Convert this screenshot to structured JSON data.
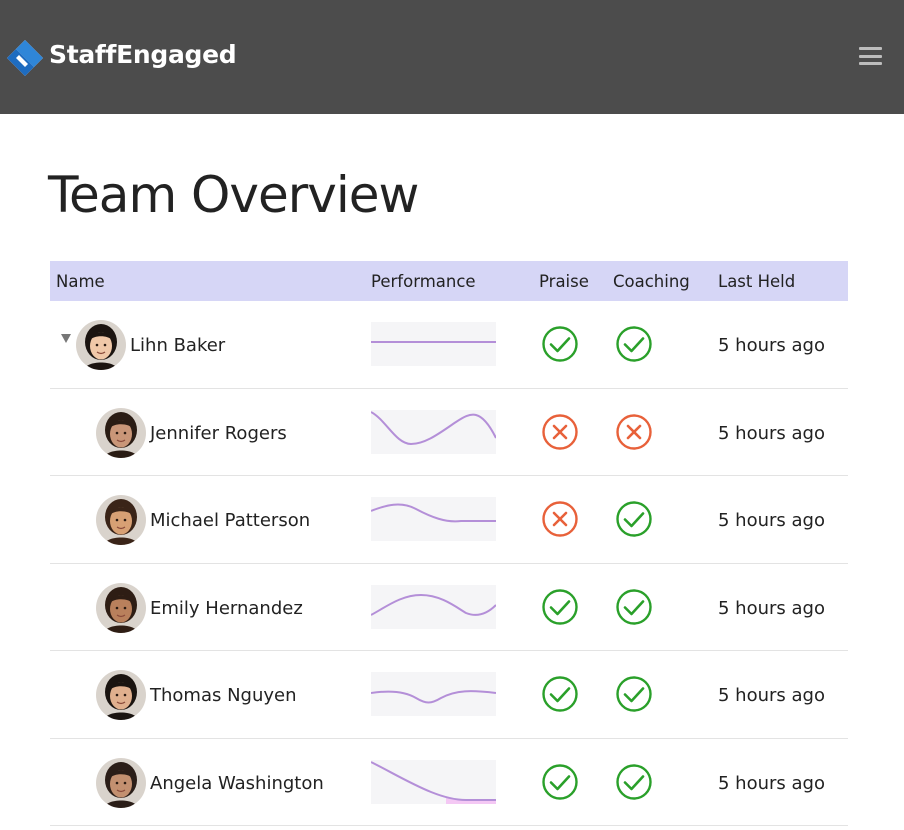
{
  "header": {
    "brand": "StaffEngaged",
    "logo_icon": "diamond-logo-icon",
    "menu_icon": "hamburger-icon"
  },
  "page": {
    "title": "Team Overview"
  },
  "table": {
    "columns": [
      "Name",
      "Performance",
      "Praise",
      "Coaching",
      "Last Held"
    ],
    "rows": [
      {
        "name": "Lihn Baker",
        "expanded": true,
        "praise": "yes",
        "coaching": "yes",
        "last_held": "5 hours ago",
        "skin": "#f0c8a8",
        "hair": "#1b1410"
      },
      {
        "name": "Jennifer Rogers",
        "praise": "no",
        "coaching": "no",
        "last_held": "5 hours ago",
        "skin": "#c99678",
        "hair": "#2a1c14"
      },
      {
        "name": "Michael Patterson",
        "praise": "no",
        "coaching": "yes",
        "last_held": "5 hours ago",
        "skin": "#d7a074",
        "hair": "#3a2418"
      },
      {
        "name": "Emily Hernandez",
        "praise": "yes",
        "coaching": "yes",
        "last_held": "5 hours ago",
        "skin": "#b9805c",
        "hair": "#2e1d14"
      },
      {
        "name": "Thomas Nguyen",
        "praise": "yes",
        "coaching": "yes",
        "last_held": "5 hours ago",
        "skin": "#e0b08e",
        "hair": "#1a1410"
      },
      {
        "name": "Angela Washington",
        "praise": "yes",
        "coaching": "yes",
        "last_held": "5 hours ago",
        "skin": "#c39070",
        "hair": "#2b1e18"
      }
    ]
  },
  "colors": {
    "header_bg": "#4c4c4c",
    "table_header_bg": "#d6d6f6",
    "check": "#2aa02a",
    "cross": "#e8613a",
    "spark_line": "#b48fd8"
  }
}
